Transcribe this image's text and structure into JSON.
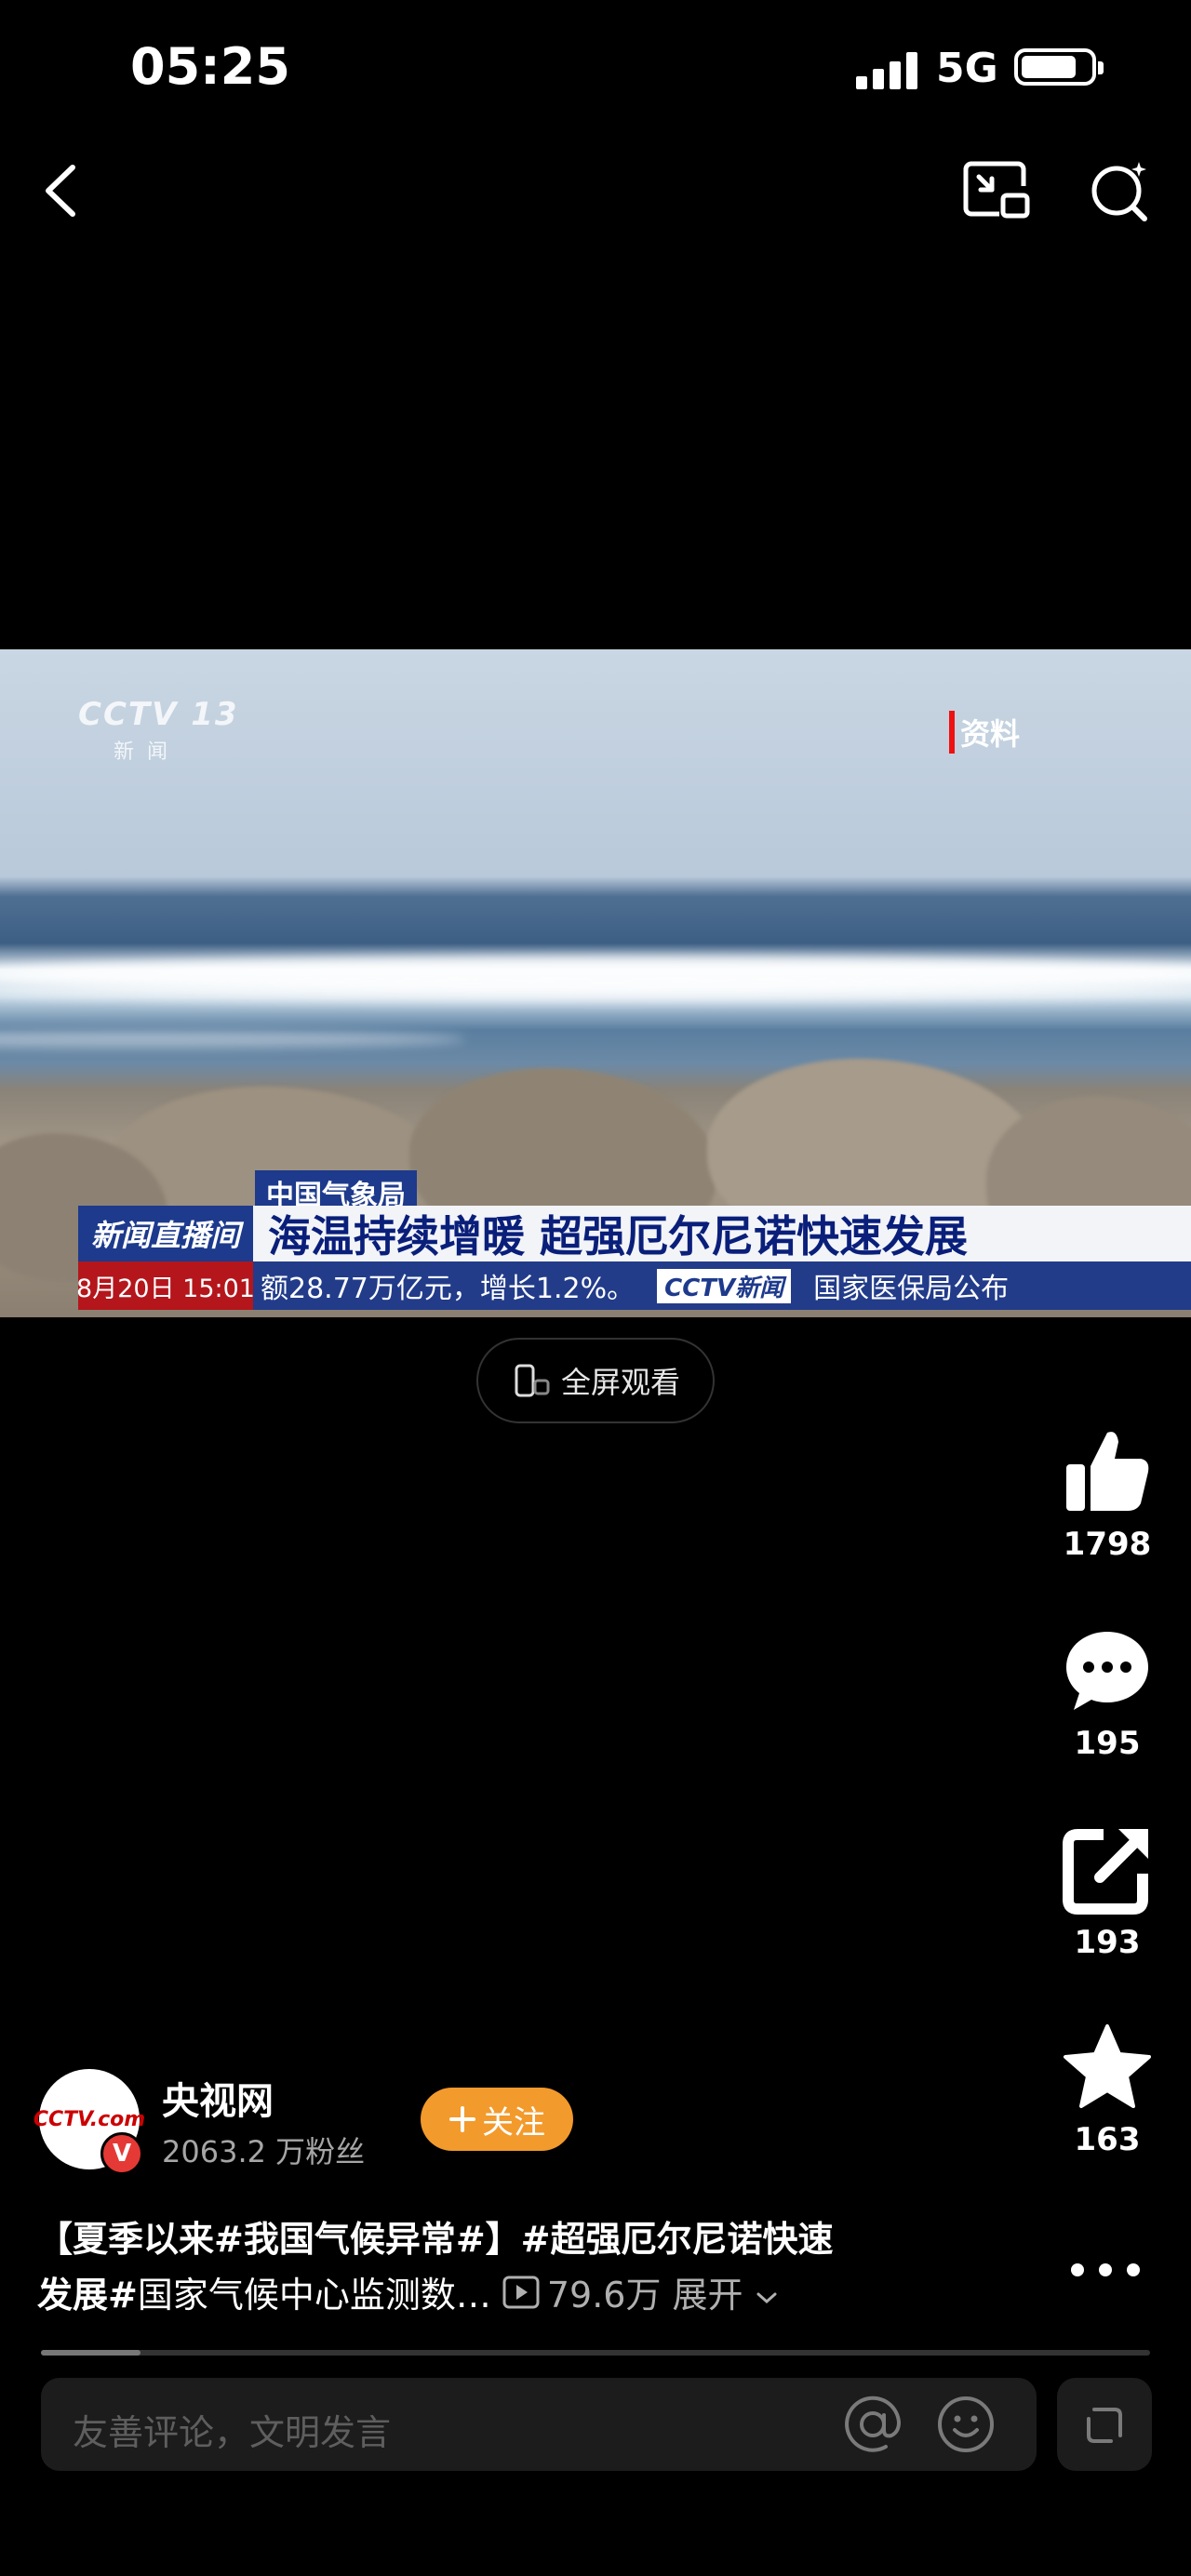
{
  "status_bar": {
    "time": "05:25",
    "network": "5G",
    "battery_level": 0.8,
    "signal_bars": 4
  },
  "nav": {
    "icons": [
      "back-icon",
      "picture-in-picture-icon",
      "search-sparkle-icon"
    ]
  },
  "video": {
    "watermark_logo": "CCTV 13",
    "watermark_sub": "新闻",
    "archive_tag": "资料",
    "source_tag": "中国气象局",
    "program_label": "新闻直播间",
    "headline": "海温持续增暖 超强厄尔尼诺快速发展",
    "date_time": "8月20日 15:01",
    "ticker_text": "额28.77万亿元，增长1.2%。",
    "ticker_logo": "CCTV新闻",
    "ticker_text2": "国家医保局公布"
  },
  "fullscreen_button": {
    "label": "全屏观看",
    "icon": "rotate-phone-icon"
  },
  "actions": [
    {
      "name": "like",
      "icon": "thumbs-up-icon",
      "count": "1798"
    },
    {
      "name": "comment",
      "icon": "comment-bubble-icon",
      "count": "195"
    },
    {
      "name": "share",
      "icon": "share-icon",
      "count": "193"
    },
    {
      "name": "favorite",
      "icon": "star-icon",
      "count": "163"
    }
  ],
  "author": {
    "avatar_text": "CCTV.com",
    "verified_badge": "V",
    "name": "央视网",
    "fans": "2063.2 万粉丝",
    "follow_label": "关注"
  },
  "caption": {
    "line1": "【夏季以来#我国气候异常#】#超强厄尔尼诺快速",
    "line2_bold": "发展#",
    "line2_rest": "国家气候中心监测数…",
    "views": "79.6万",
    "expand": "展开"
  },
  "progress": {
    "fraction": 0.09
  },
  "comment_bar": {
    "placeholder": "友善评论，文明发言"
  },
  "colors": {
    "accent_follow": "#f39a2c",
    "background": "#000000"
  }
}
